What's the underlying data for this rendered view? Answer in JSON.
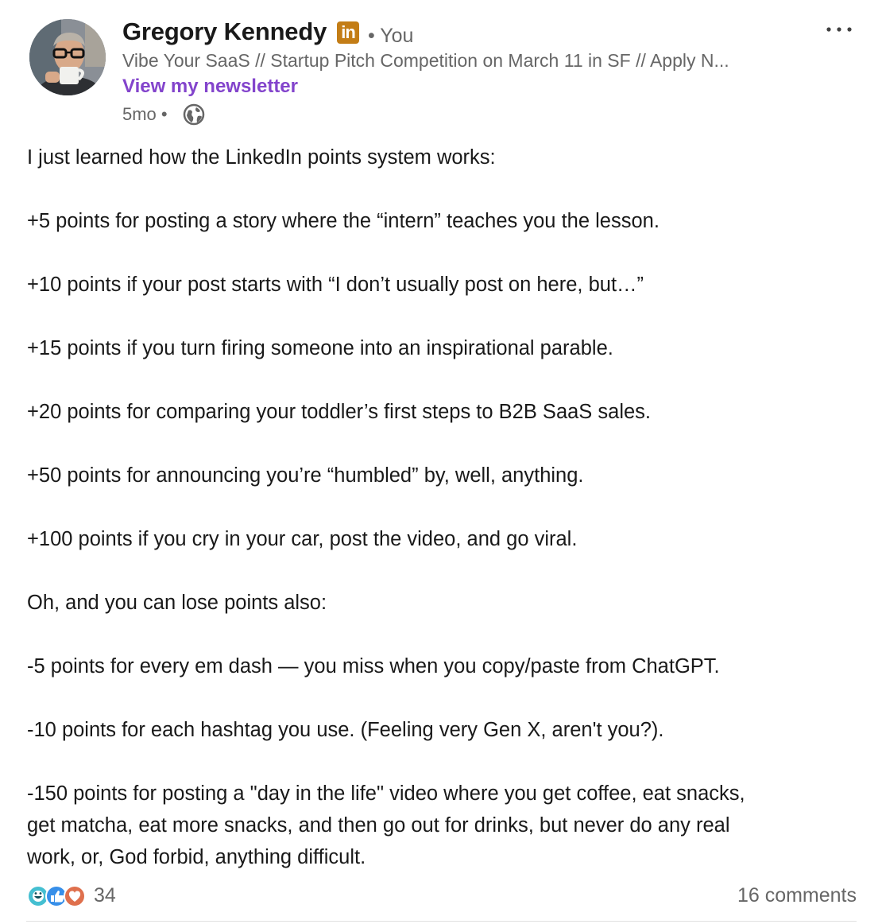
{
  "author": {
    "name": "Gregory Kennedy",
    "badge_text": "in",
    "degree": "• You",
    "headline": "Vibe Your SaaS // Startup Pitch Competition on March 11 in SF // Apply N...",
    "newsletter_link": "View my newsletter",
    "timestamp": "5mo •",
    "visibility_icon": "globe-icon"
  },
  "menu_icon": "more-horizontal-icon",
  "post_lines": [
    "I just learned how the LinkedIn points system works:",
    "",
    "+5 points for posting a story where the “intern” teaches you the lesson.",
    "",
    "+10 points if your post starts with “I don’t usually post on here, but…”",
    "",
    "+15 points if you turn firing someone into an inspirational parable.",
    "",
    "+20 points for comparing your toddler’s first steps to B2B SaaS sales.",
    "",
    "+50 points for announcing you’re “humbled” by, well, anything.",
    "",
    "+100 points if you cry in your car, post the video, and go viral.",
    "",
    "Oh, and you can lose points also:",
    "",
    "-5 points for every em dash — you miss when you copy/paste from ChatGPT.",
    "",
    "-10 points for each hashtag you use. (Feeling very Gen X, aren't you?).",
    "",
    "-150 points for posting a \"day in the life\" video where you get coffee, eat snacks,",
    "get matcha, eat more snacks, and then go out for drinks, but never do any real",
    "work, or, God forbid, anything difficult."
  ],
  "social": {
    "reaction_icons": [
      "funny-icon",
      "like-icon",
      "love-icon"
    ],
    "reaction_count": "34",
    "comments": "16 comments"
  },
  "colors": {
    "name": "#191919",
    "secondary": "#666666",
    "newsletter": "#8344cc",
    "premium_badge": "#c37d16",
    "funny": "#44bfd1",
    "like": "#378fe9",
    "love": "#df704d"
  }
}
